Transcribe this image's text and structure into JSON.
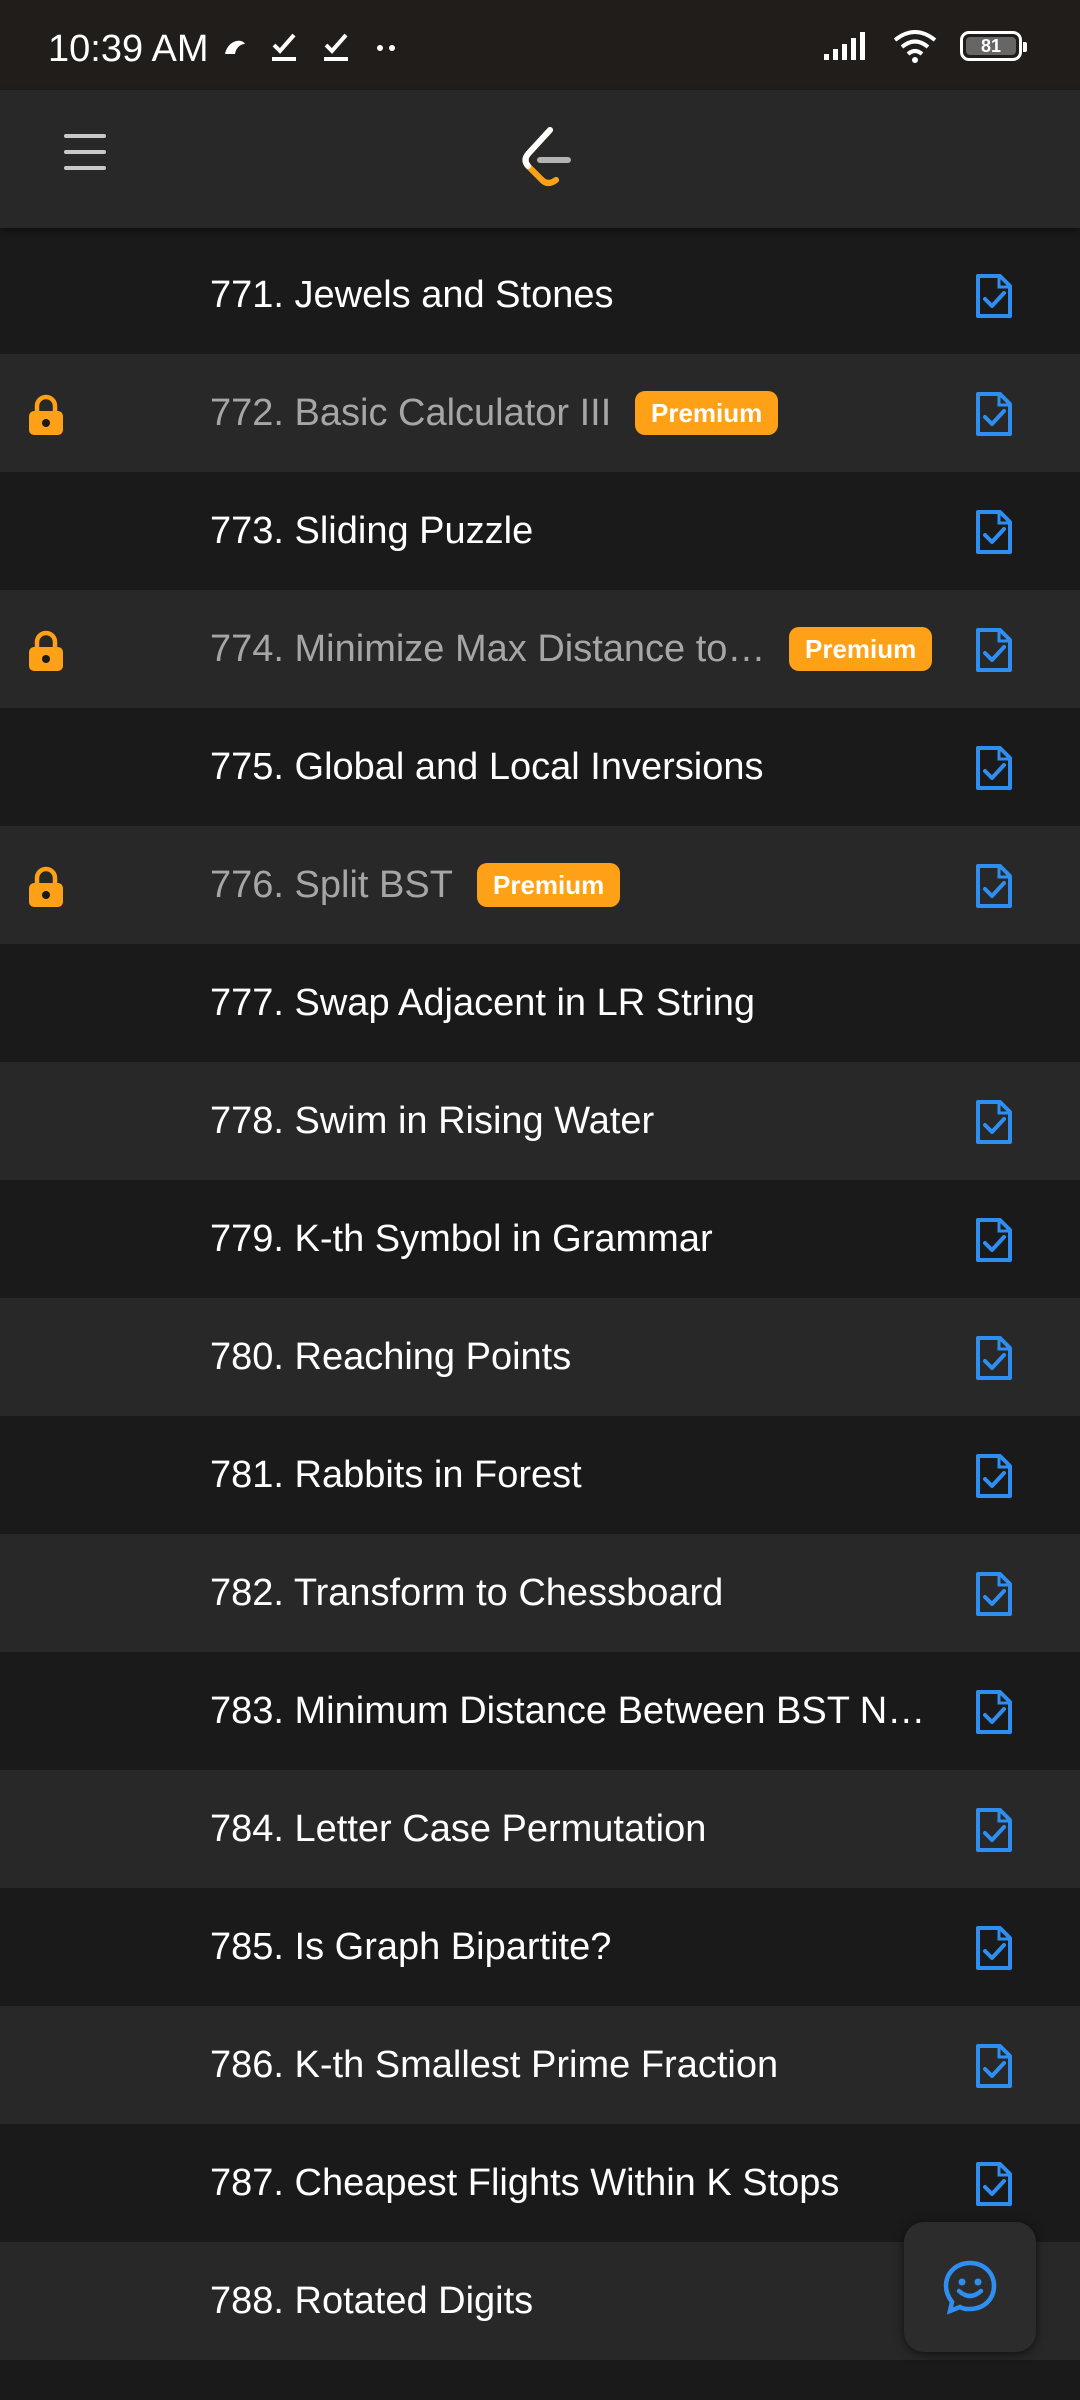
{
  "status_bar": {
    "time": "10:39 AM",
    "battery": "81"
  },
  "colors": {
    "accent": "#ffa116",
    "solution": "#2f8ff0",
    "row_dark": "#1a1a1a",
    "row_light": "#282828"
  },
  "problems": [
    {
      "label": "771. Jewels and Stones",
      "premium": false,
      "has_solution": true
    },
    {
      "label": "772. Basic Calculator III",
      "premium": true,
      "has_solution": true
    },
    {
      "label": "773. Sliding Puzzle",
      "premium": false,
      "has_solution": true
    },
    {
      "label": "774. Minimize Max Distance to…",
      "premium": true,
      "has_solution": true
    },
    {
      "label": "775. Global and Local Inversions",
      "premium": false,
      "has_solution": true
    },
    {
      "label": "776. Split BST",
      "premium": true,
      "has_solution": true
    },
    {
      "label": "777. Swap Adjacent in LR String",
      "premium": false,
      "has_solution": false
    },
    {
      "label": "778. Swim in Rising Water",
      "premium": false,
      "has_solution": true
    },
    {
      "label": "779. K-th Symbol in Grammar",
      "premium": false,
      "has_solution": true
    },
    {
      "label": "780. Reaching Points",
      "premium": false,
      "has_solution": true
    },
    {
      "label": "781. Rabbits in Forest",
      "premium": false,
      "has_solution": true
    },
    {
      "label": "782. Transform to Chessboard",
      "premium": false,
      "has_solution": true
    },
    {
      "label": "783. Minimum Distance Between BST N…",
      "premium": false,
      "has_solution": true
    },
    {
      "label": "784. Letter Case Permutation",
      "premium": false,
      "has_solution": true
    },
    {
      "label": "785. Is Graph Bipartite?",
      "premium": false,
      "has_solution": true
    },
    {
      "label": "786. K-th Smallest Prime Fraction",
      "premium": false,
      "has_solution": true
    },
    {
      "label": "787. Cheapest Flights Within K Stops",
      "premium": false,
      "has_solution": true
    },
    {
      "label": "788. Rotated Digits",
      "premium": false,
      "has_solution": false
    }
  ],
  "premium_label": "Premium",
  "icons": {
    "menu": "hamburger-icon",
    "logo": "leetcode-logo",
    "lock": "lock-icon",
    "solution": "solution-file-icon",
    "chat": "chat-smiley-icon"
  }
}
